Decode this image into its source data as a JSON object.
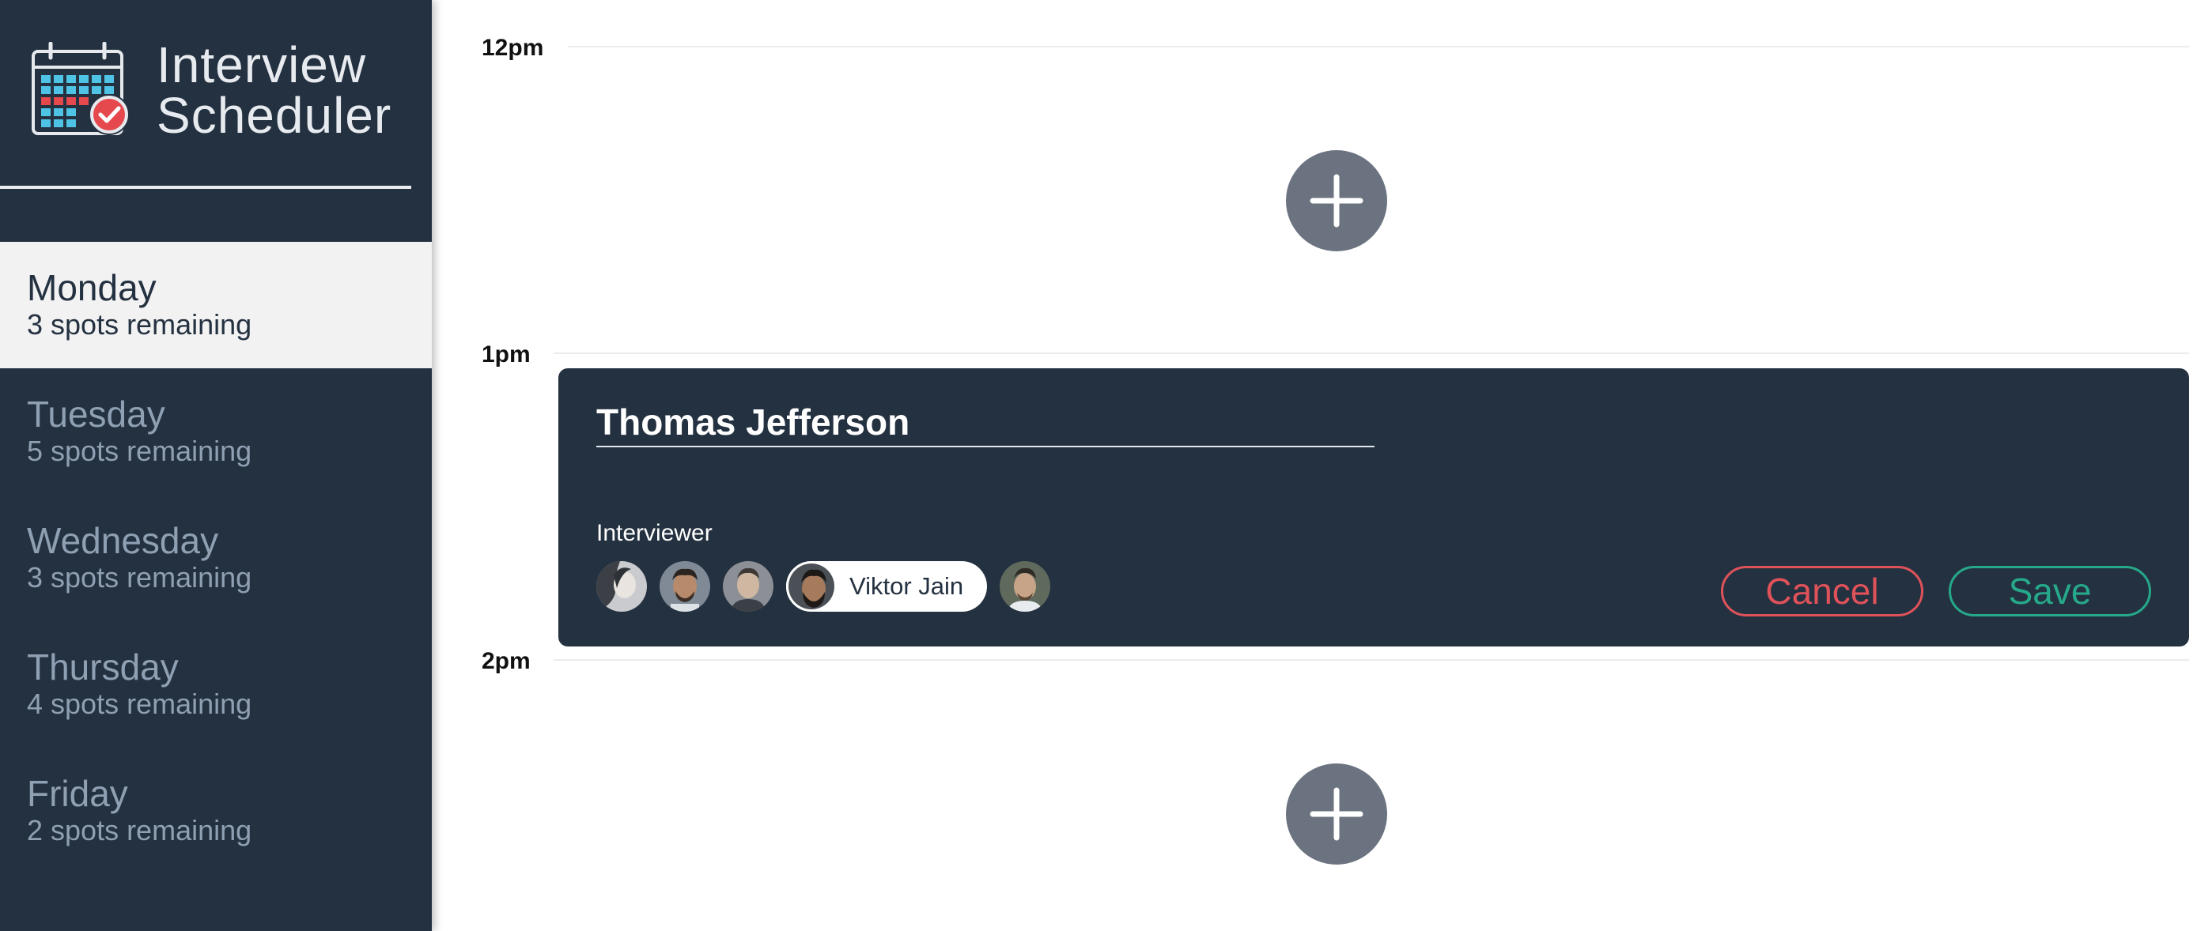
{
  "app": {
    "title_line1": "Interview",
    "title_line2": "Scheduler"
  },
  "sidebar": {
    "days": [
      {
        "name": "Monday",
        "spots": "3 spots remaining",
        "active": true
      },
      {
        "name": "Tuesday",
        "spots": "5 spots remaining",
        "active": false
      },
      {
        "name": "Wednesday",
        "spots": "3 spots remaining",
        "active": false
      },
      {
        "name": "Thursday",
        "spots": "4 spots remaining",
        "active": false
      },
      {
        "name": "Friday",
        "spots": "2 spots remaining",
        "active": false
      }
    ]
  },
  "schedule": {
    "times": [
      "12pm",
      "1pm",
      "2pm"
    ]
  },
  "appointment_form": {
    "student_name": "Thomas Jefferson",
    "interviewer_label": "Interviewer",
    "selected_interviewer": "Viktor Jain",
    "cancel_label": "Cancel",
    "save_label": "Save"
  },
  "icons": {
    "logo": "calendar-check-icon",
    "add": "plus-icon"
  },
  "colors": {
    "sidebar_bg": "#243140",
    "active_day_bg": "#f2f2f2",
    "cancel": "#e0525a",
    "save": "#26a98a",
    "add_button": "#6b7380"
  }
}
